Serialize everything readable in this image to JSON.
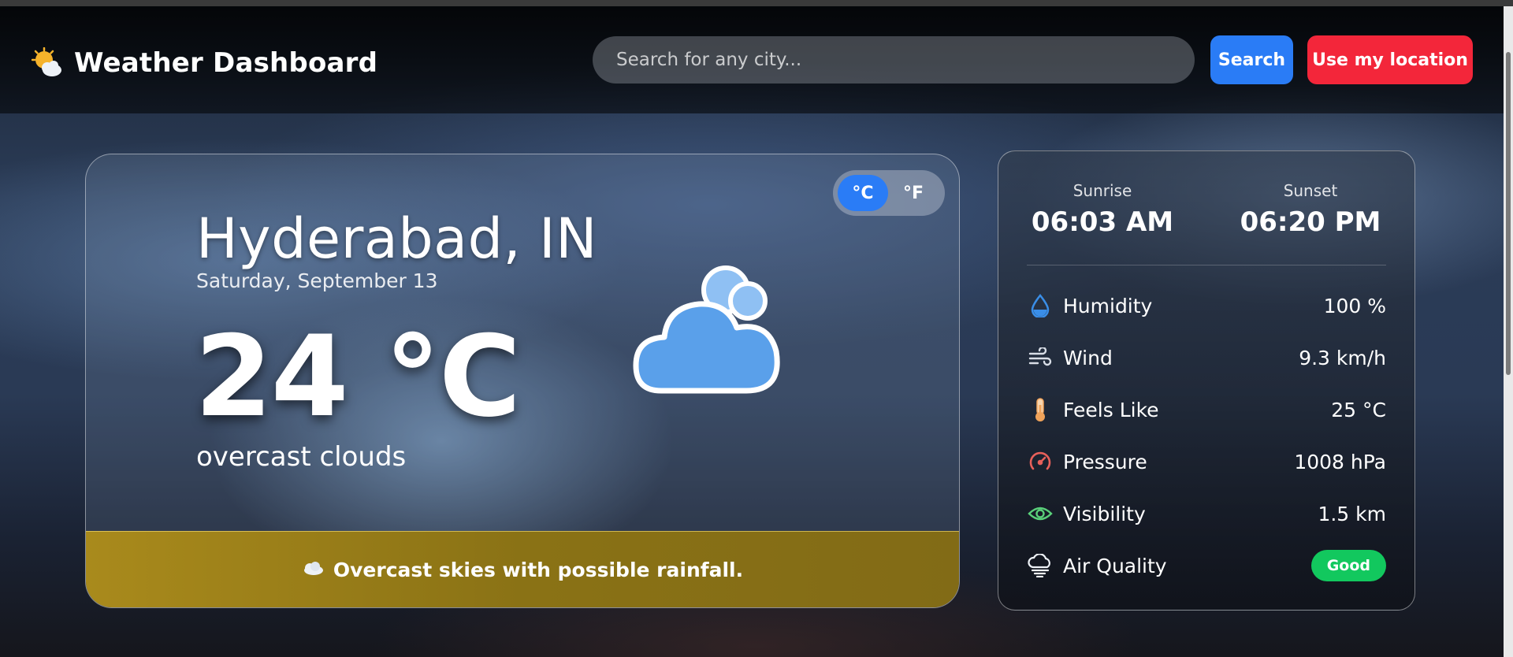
{
  "header": {
    "app_title": "Weather Dashboard",
    "brand_icon": "sun-behind-cloud-icon",
    "search_placeholder": "Search for any city...",
    "search_button": "Search",
    "location_button": "Use my location"
  },
  "current": {
    "city": "Hyderabad, IN",
    "date": "Saturday, September 13",
    "temperature": "24 °C",
    "description": "overcast clouds",
    "icon": "cloud-icon",
    "units": {
      "celsius": "°C",
      "fahrenheit": "°F",
      "selected": "°C"
    },
    "banner": {
      "icon": "cloud-icon",
      "text": "Overcast skies with possible rainfall."
    }
  },
  "sun": {
    "sunrise_label": "Sunrise",
    "sunrise_time": "06:03 AM",
    "sunset_label": "Sunset",
    "sunset_time": "06:20 PM"
  },
  "stats": {
    "humidity": {
      "label": "Humidity",
      "value": "100 %",
      "icon": "droplet-icon",
      "color": "#3a8ee8"
    },
    "wind": {
      "label": "Wind",
      "value": "9.3 km/h",
      "icon": "wind-icon",
      "color": "#d8dde6"
    },
    "feels_like": {
      "label": "Feels Like",
      "value": "25 °C",
      "icon": "thermometer-icon",
      "color": "#f0a35a"
    },
    "pressure": {
      "label": "Pressure",
      "value": "1008 hPa",
      "icon": "gauge-icon",
      "color": "#e8605a"
    },
    "visibility": {
      "label": "Visibility",
      "value": "1.5 km",
      "icon": "eye-icon",
      "color": "#5ad07a"
    },
    "air_quality": {
      "label": "Air Quality",
      "value": "Good",
      "icon": "cloud-wind-icon",
      "badge_color": "#12c85e"
    }
  },
  "colors": {
    "accent_blue": "#2a7cf6",
    "accent_red": "#f3263a",
    "banner_gold": "#a98a1c"
  }
}
